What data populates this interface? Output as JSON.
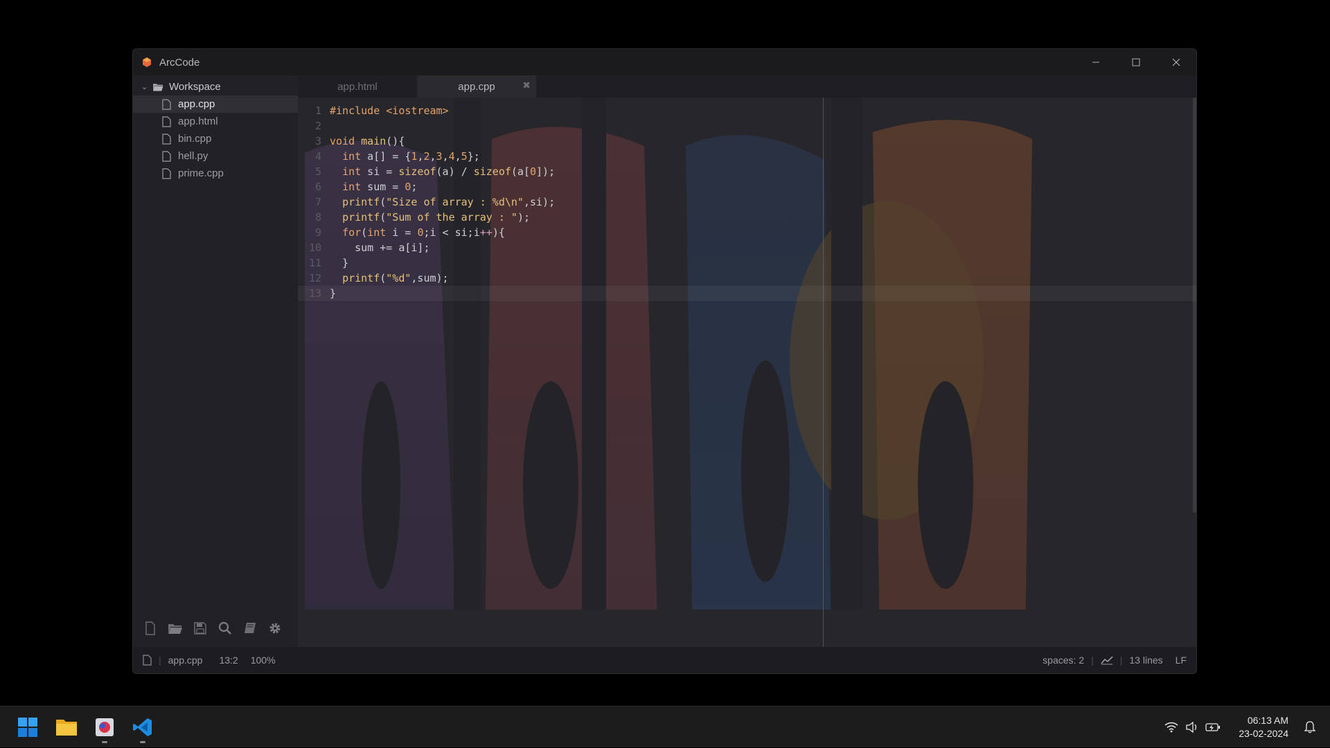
{
  "window": {
    "title": "ArcCode"
  },
  "explorer": {
    "root": "Workspace",
    "files": [
      "app.cpp",
      "app.html",
      "bin.cpp",
      "hell.py",
      "prime.cpp"
    ],
    "active_index": 0,
    "tools": [
      "new-file-icon",
      "open-folder-icon",
      "save-icon",
      "search-icon",
      "book-icon",
      "gear-icon"
    ]
  },
  "tabs": [
    {
      "label": "app.html",
      "active": false
    },
    {
      "label": "app.cpp",
      "active": true,
      "close": "✖"
    }
  ],
  "editor": {
    "line_numbers": [
      "1",
      "2",
      "3",
      "4",
      "5",
      "6",
      "7",
      "8",
      "9",
      "10",
      "11",
      "12",
      "13"
    ],
    "current_line": 13,
    "lines": [
      "#include <iostream>",
      "",
      "void main(){",
      "  int a[] = {1,2,3,4,5};",
      "  int si = sizeof(a) / sizeof(a[0]);",
      "  int sum = 0;",
      "  printf(\"Size of array : %d\\n\",si);",
      "  printf(\"Sum of the array : \");",
      "  for(int i = 0;i < si;i++){",
      "    sum += a[i];",
      "  }",
      "  printf(\"%d\",sum);",
      "}"
    ]
  },
  "status": {
    "file": "app.cpp",
    "cursor": "13:2",
    "zoom": "100%",
    "indent": "spaces: 2",
    "lines": "13 lines",
    "eol": "LF"
  },
  "taskbar": {
    "time": "06:13 AM",
    "date": "23-02-2024"
  },
  "colors": {
    "accent": "#e6a46a",
    "string": "#e6c07a",
    "operator": "#d89fc0"
  }
}
